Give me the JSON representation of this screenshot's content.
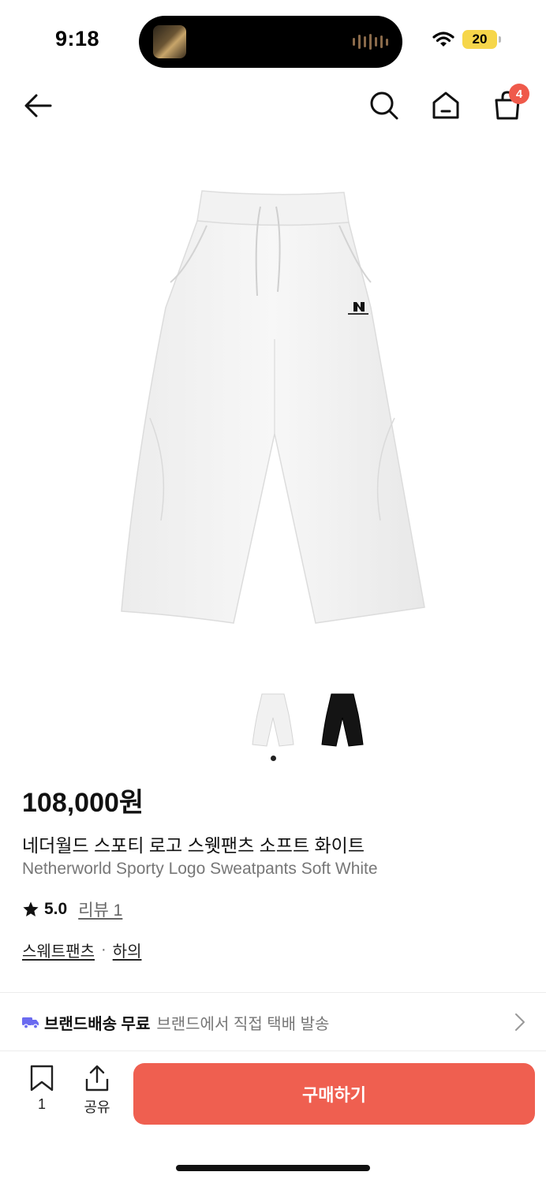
{
  "status_bar": {
    "time": "9:18",
    "battery": "20"
  },
  "nav": {
    "back_icon": "arrow-left-icon",
    "search_icon": "search-icon",
    "home_icon": "home-icon",
    "cart_icon": "shopping-bag-icon",
    "cart_count": "4"
  },
  "product": {
    "price": "108,000원",
    "title_ko": "네더월드 스포티 로고 스웻팬츠 소프트 화이트",
    "title_en": "Netherworld Sporty Logo Sweatpants Soft White",
    "rating": "5.0",
    "review_label": "리뷰 1",
    "categories": [
      "스웨트팬츠",
      "하의"
    ],
    "category_sep": "·",
    "thumbnails": [
      "white-pants-thumbnail",
      "black-pants-thumbnail"
    ]
  },
  "delivery": {
    "icon": "truck-icon",
    "strong": "브랜드배송 무료",
    "sub": "브랜드에서 직접 택배 발송"
  },
  "bottom_bar": {
    "bookmark_count": "1",
    "share_label": "공유",
    "buy_label": "구매하기"
  },
  "colors": {
    "accent": "#ef5f50",
    "badge": "#ef5a4b",
    "delivery_icon": "#6b6bf0"
  }
}
